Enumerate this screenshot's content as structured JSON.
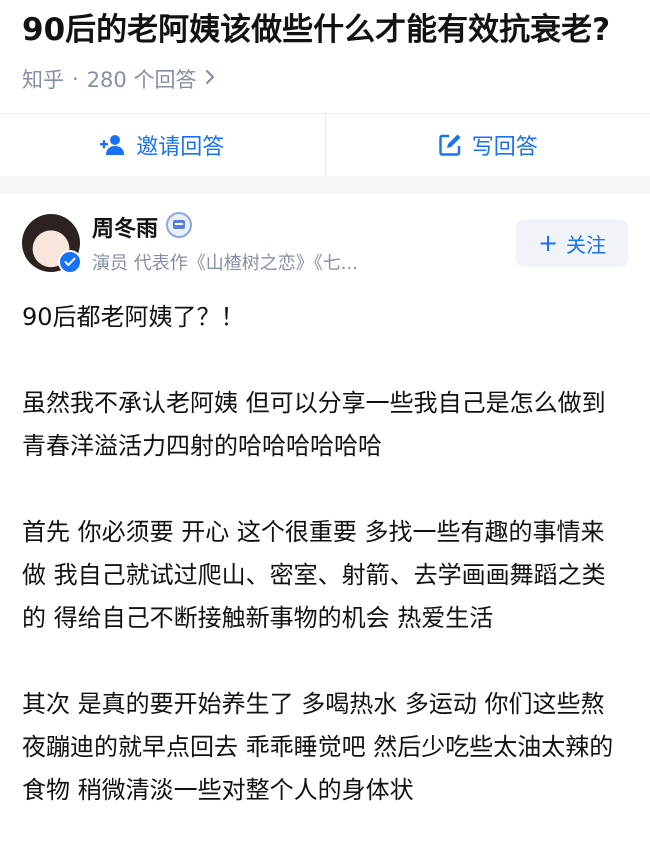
{
  "question": {
    "title": "90后的老阿姨该做些什么才能有效抗衰老?",
    "source": "知乎",
    "separator": "·",
    "answer_count": "280 个回答",
    "chevron_icon": "chevron-right-icon"
  },
  "actions": {
    "invite_label": "邀请回答",
    "invite_icon": "add-person-icon",
    "write_label": "写回答",
    "write_icon": "edit-icon"
  },
  "author": {
    "name": "周冬雨",
    "description": "演员 代表作《山楂树之恋》《七...",
    "follow_label": "关注",
    "badge_icon": "creator-badge-icon",
    "verified_icon": "verified-check-icon"
  },
  "answer": {
    "paragraphs": [
      "90后都老阿姨了？！",
      "虽然我不承认老阿姨 但可以分享一些我自己是怎么做到 青春洋溢活力四射的哈哈哈哈哈哈",
      "首先 你必须要 开心 这个很重要 多找一些有趣的事情来做 我自己就试过爬山、密室、射箭、去学画画舞蹈之类的 得给自己不断接触新事物的机会 热爱生活",
      "其次 是真的要开始养生了 多喝热水 多运动 你们这些熬夜蹦迪的就早点回去 乖乖睡觉吧 然后少吃些太油太辣的食物 稍微清淡一些对整个人的身体状"
    ]
  },
  "colors": {
    "accent": "#1772f6",
    "muted": "#8590a6",
    "text": "#121212"
  }
}
